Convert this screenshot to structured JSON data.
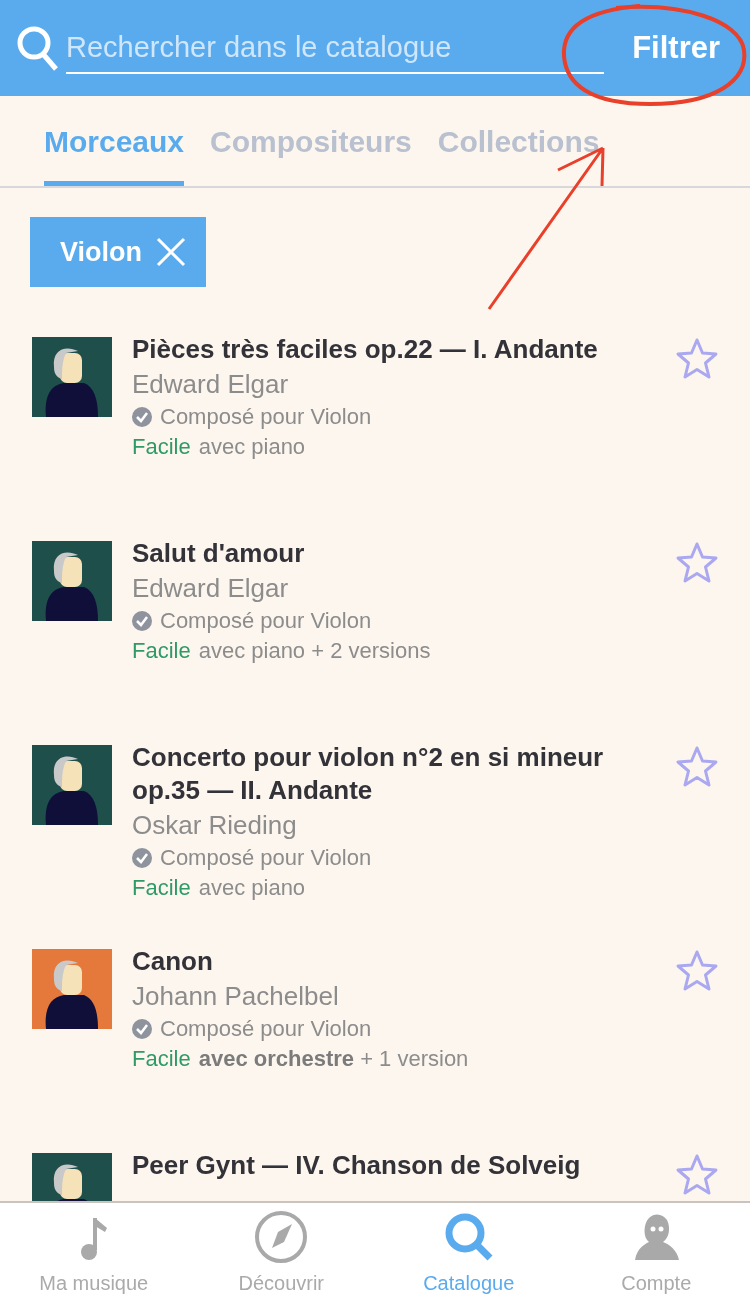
{
  "search": {
    "placeholder": "Rechercher dans le catalogue"
  },
  "filter_button": "Filtrer",
  "tabs": [
    {
      "label": "Morceaux",
      "selected": true
    },
    {
      "label": "Compositeurs",
      "selected": false
    },
    {
      "label": "Collections",
      "selected": false
    }
  ],
  "filter_chips": [
    {
      "label": "Violon"
    }
  ],
  "pieces": [
    {
      "title": "Pièces très faciles op.22 — I. Andante",
      "composer": "Edward Elgar",
      "composed_for": "Composé pour Violon",
      "level": "Facile",
      "versions": "avec piano",
      "color": "#1f4f4b",
      "favorite": false
    },
    {
      "title": "Salut d'amour",
      "composer": "Edward Elgar",
      "composed_for": "Composé pour Violon",
      "level": "Facile",
      "versions": "avec piano + 2 versions",
      "color": "#1f4f4b",
      "favorite": false
    },
    {
      "title": "Concerto pour violon n°2 en si mineur op.35 — II. Andante",
      "composer": "Oskar Rieding",
      "composed_for": "Composé pour Violon",
      "level": "Facile",
      "versions": "avec piano",
      "color": "#1f4f4b",
      "favorite": false
    },
    {
      "title": "Canon",
      "composer": "Johann Pachelbel",
      "composed_for": "Composé pour Violon",
      "level": "Facile",
      "versions": "**avec orchestre** + 1 version",
      "color": "#e5793b",
      "favorite": false
    },
    {
      "title": "Peer Gynt — IV. Chanson de Solveig",
      "color": "#1f4f4b",
      "favorite": false
    }
  ],
  "bottom_nav": [
    {
      "label": "Ma musique",
      "kind": "note",
      "selected": false
    },
    {
      "label": "Découvrir",
      "kind": "compass",
      "selected": false
    },
    {
      "label": "Catalogue",
      "kind": "search",
      "selected": true
    },
    {
      "label": "Compte",
      "kind": "person",
      "selected": false
    }
  ]
}
